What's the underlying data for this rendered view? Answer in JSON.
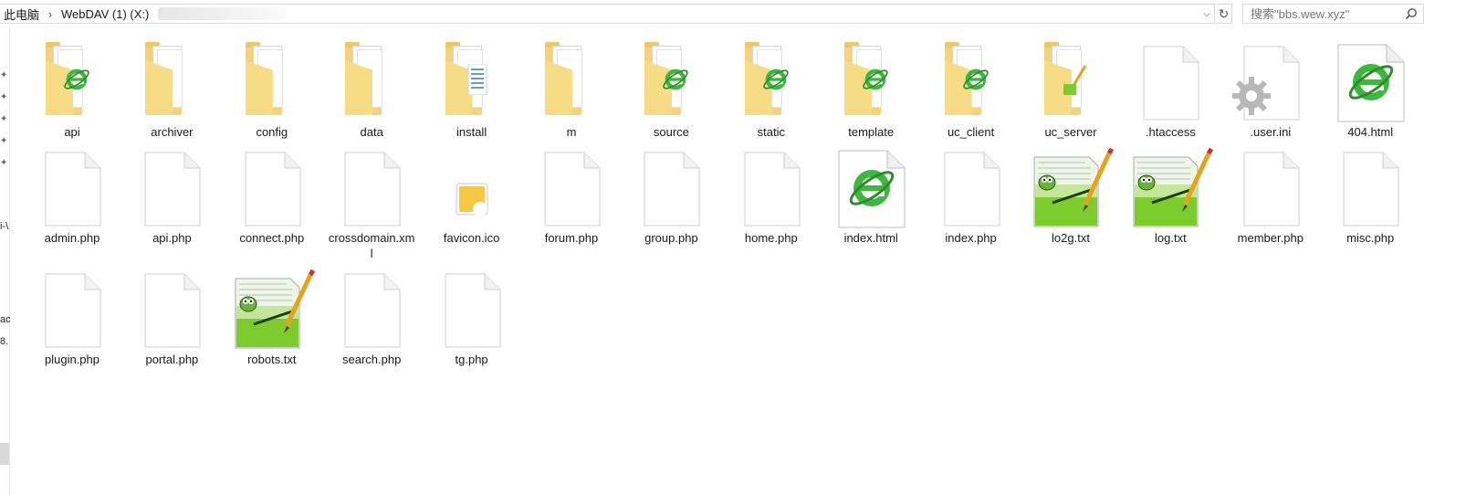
{
  "address": {
    "crumbs": [
      "此电脑",
      "WebDAV (1) (X:)"
    ],
    "separator": "›"
  },
  "search": {
    "placeholder": "搜索\"bbs.wew.xyz\""
  },
  "nav": {
    "fragments": [
      "i-\\",
      "ac",
      "8."
    ]
  },
  "colors": {
    "folder": "#f3d27a",
    "ie_green": "#3cb83c",
    "selection": "#d9d9d9"
  },
  "files": [
    {
      "name": "api",
      "icon": "folder-ie-icon"
    },
    {
      "name": "archiver",
      "icon": "folder-icon"
    },
    {
      "name": "config",
      "icon": "folder-icon"
    },
    {
      "name": "data",
      "icon": "folder-icon"
    },
    {
      "name": "install",
      "icon": "folder-doc-icon"
    },
    {
      "name": "m",
      "icon": "folder-icon"
    },
    {
      "name": "source",
      "icon": "folder-ie-icon"
    },
    {
      "name": "static",
      "icon": "folder-ie-icon"
    },
    {
      "name": "template",
      "icon": "folder-ie-icon"
    },
    {
      "name": "uc_client",
      "icon": "folder-ie-icon"
    },
    {
      "name": "uc_server",
      "icon": "folder-notepad-icon"
    },
    {
      "name": ".htaccess",
      "icon": "blank-file-icon"
    },
    {
      "name": ".user.ini",
      "icon": "settings-file-icon"
    },
    {
      "name": "404.html",
      "icon": "html-file-icon"
    },
    {
      "name": "admin.php",
      "icon": "blank-file-icon"
    },
    {
      "name": "api.php",
      "icon": "blank-file-icon"
    },
    {
      "name": "connect.php",
      "icon": "blank-file-icon"
    },
    {
      "name": "crossdomain.xml",
      "icon": "blank-file-icon"
    },
    {
      "name": "favicon.ico",
      "icon": "image-file-icon"
    },
    {
      "name": "forum.php",
      "icon": "blank-file-icon"
    },
    {
      "name": "group.php",
      "icon": "blank-file-icon"
    },
    {
      "name": "home.php",
      "icon": "blank-file-icon"
    },
    {
      "name": "index.html",
      "icon": "html-file-icon"
    },
    {
      "name": "index.php",
      "icon": "blank-file-icon"
    },
    {
      "name": "lo2g.txt",
      "icon": "notepad-file-icon"
    },
    {
      "name": "log.txt",
      "icon": "notepad-file-icon"
    },
    {
      "name": "member.php",
      "icon": "blank-file-icon"
    },
    {
      "name": "misc.php",
      "icon": "blank-file-icon"
    },
    {
      "name": "plugin.php",
      "icon": "blank-file-icon"
    },
    {
      "name": "portal.php",
      "icon": "blank-file-icon"
    },
    {
      "name": "robots.txt",
      "icon": "notepad-file-icon"
    },
    {
      "name": "search.php",
      "icon": "blank-file-icon"
    },
    {
      "name": "tg.php",
      "icon": "blank-file-icon"
    }
  ]
}
